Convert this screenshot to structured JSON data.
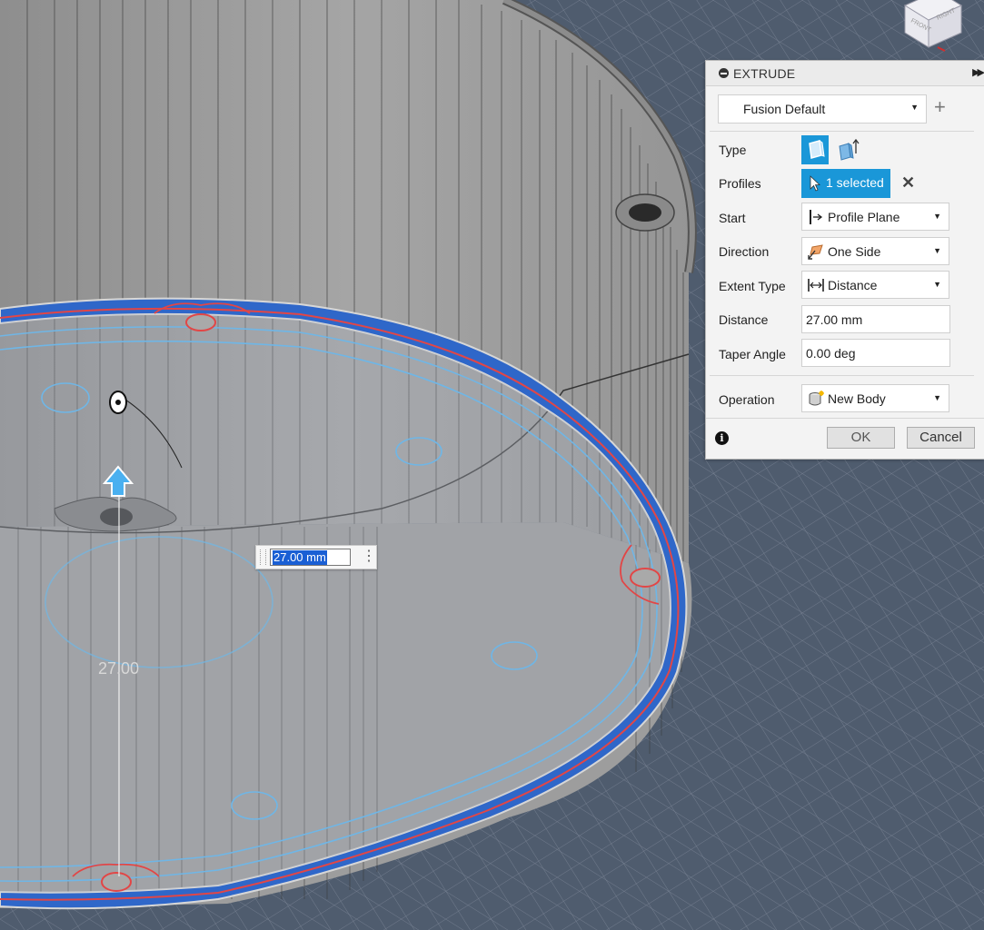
{
  "viewport": {
    "dimension_label": "27.00",
    "dimension_input_value": "27.00 mm"
  },
  "panel": {
    "title": "EXTRUDE",
    "preset": "Fusion Default",
    "rows": {
      "type_label": "Type",
      "profiles_label": "Profiles",
      "profiles_value": "1 selected",
      "start_label": "Start",
      "start_value": "Profile Plane",
      "direction_label": "Direction",
      "direction_value": "One Side",
      "extent_label": "Extent Type",
      "extent_value": "Distance",
      "distance_label": "Distance",
      "distance_value": "27.00 mm",
      "taper_label": "Taper Angle",
      "taper_value": "0.00 deg",
      "operation_label": "Operation",
      "operation_value": "New Body"
    },
    "ok_label": "OK",
    "cancel_label": "Cancel"
  },
  "viewcube": {
    "front_label": "FRONT",
    "right_label": "RIGHT"
  },
  "colors": {
    "background": "#4f5c6e",
    "grid": "#7d8797",
    "body_gray": "#9a9a9a",
    "selection_blue": "#2f67c9",
    "sketch_line": "#6fb6e6",
    "profile_red": "#e24646",
    "accent": "#1a97d8"
  }
}
